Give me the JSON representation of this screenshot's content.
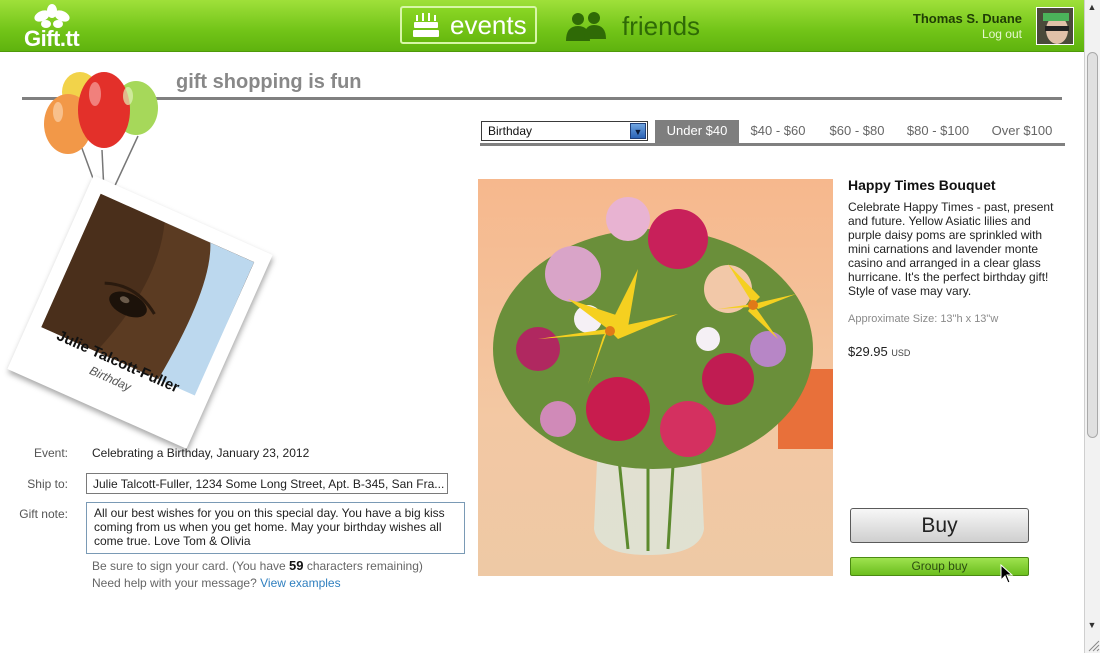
{
  "app": {
    "logo_text": "Gift.tt",
    "nav": {
      "events_label": "events",
      "friends_label": "friends"
    },
    "user": {
      "name": "Thomas S. Duane",
      "logout_label": "Log out"
    },
    "accent": "#72c418"
  },
  "header": {
    "tagline": "gift shopping is fun"
  },
  "recipient": {
    "name": "Julie Talcott-Fuller",
    "occasion": "Birthday"
  },
  "form": {
    "event_label": "Event:",
    "event_value": "Celebrating a Birthday, January 23, 2012",
    "ship_label": "Ship to:",
    "ship_value": "Julie Talcott-Fuller, 1234 Some Long Street, Apt. B-345, San Fra...",
    "note_label": "Gift note:",
    "note_value": "All our best wishes for you on this special day. You have a big kiss coming from us when you get home. May your birthday wishes all come true. Love Tom & Olivia",
    "hint_prefix": "Be sure to sign your card. (You have",
    "chars_remaining": "59",
    "hint_suffix": "characters remaining)",
    "help_text": "Need help with your message?",
    "help_link": "View examples"
  },
  "filters": {
    "occasion_selected": "Birthday",
    "price_ranges": [
      "Under $40",
      "$40 - $60",
      "$60 - $80",
      "$80 - $100",
      "Over $100"
    ],
    "active_range": "Under $40"
  },
  "product": {
    "title": "Happy Times Bouquet",
    "description": "Celebrate Happy Times - past, present and future. Yellow Asiatic lilies and purple daisy poms are sprinkled with mini carnations and lavender monte casino and arranged in a clear glass hurricane. It's the perfect birthday gift! Style of vase may vary.",
    "size": "Approximate Size: 13\"h x 13\"w",
    "price": "$29.95",
    "currency": "USD",
    "buy_label": "Buy",
    "group_buy_label": "Group buy"
  }
}
